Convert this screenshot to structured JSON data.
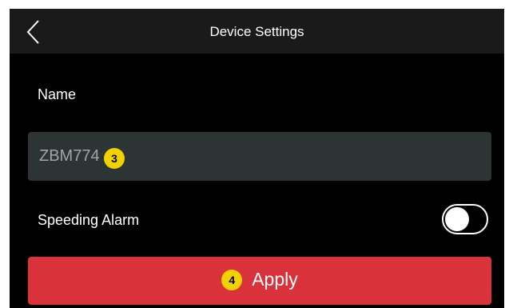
{
  "header": {
    "title": "Device Settings",
    "back_icon": "chevron-left-icon"
  },
  "form": {
    "name_label": "Name",
    "name_value": "ZBM774",
    "name_badge": "3",
    "speeding_alarm_label": "Speeding Alarm",
    "speeding_alarm_enabled": false
  },
  "apply": {
    "label": "Apply",
    "badge": "4"
  },
  "colors": {
    "background": "#000000",
    "header": "#1a1a1a",
    "field": "#2c3534",
    "apply": "#d9323b",
    "badge": "#f2d100"
  }
}
